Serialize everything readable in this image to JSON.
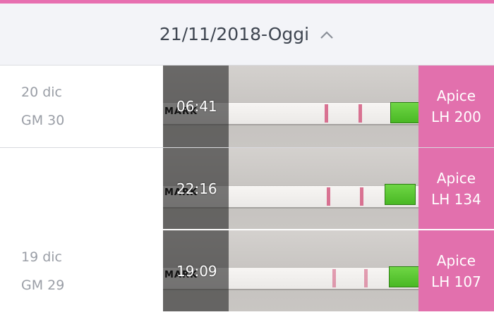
{
  "header": {
    "date_range": "21/11/2018-Oggi",
    "toggle_icon": "chevron-up-icon"
  },
  "colors": {
    "accent": "#e76fb0",
    "badge": "#e270ad",
    "test_tab": "#5cc832",
    "test_line": "#d2537a"
  },
  "rows": [
    {
      "date": "20 dic",
      "cycle_day": "GM 30",
      "tests": [
        {
          "time": "06:41",
          "mark_text": "MARK",
          "result_label": "Apice",
          "result_value": "LH 200"
        }
      ]
    },
    {
      "date": "19 dic",
      "cycle_day": "GM 29",
      "tests": [
        {
          "time": "22:16",
          "mark_text": "MARK",
          "result_label": "Apice",
          "result_value": "LH 134"
        },
        {
          "time": "19:09",
          "mark_text": "MARK",
          "result_label": "Apice",
          "result_value": "LH 107"
        }
      ]
    }
  ]
}
